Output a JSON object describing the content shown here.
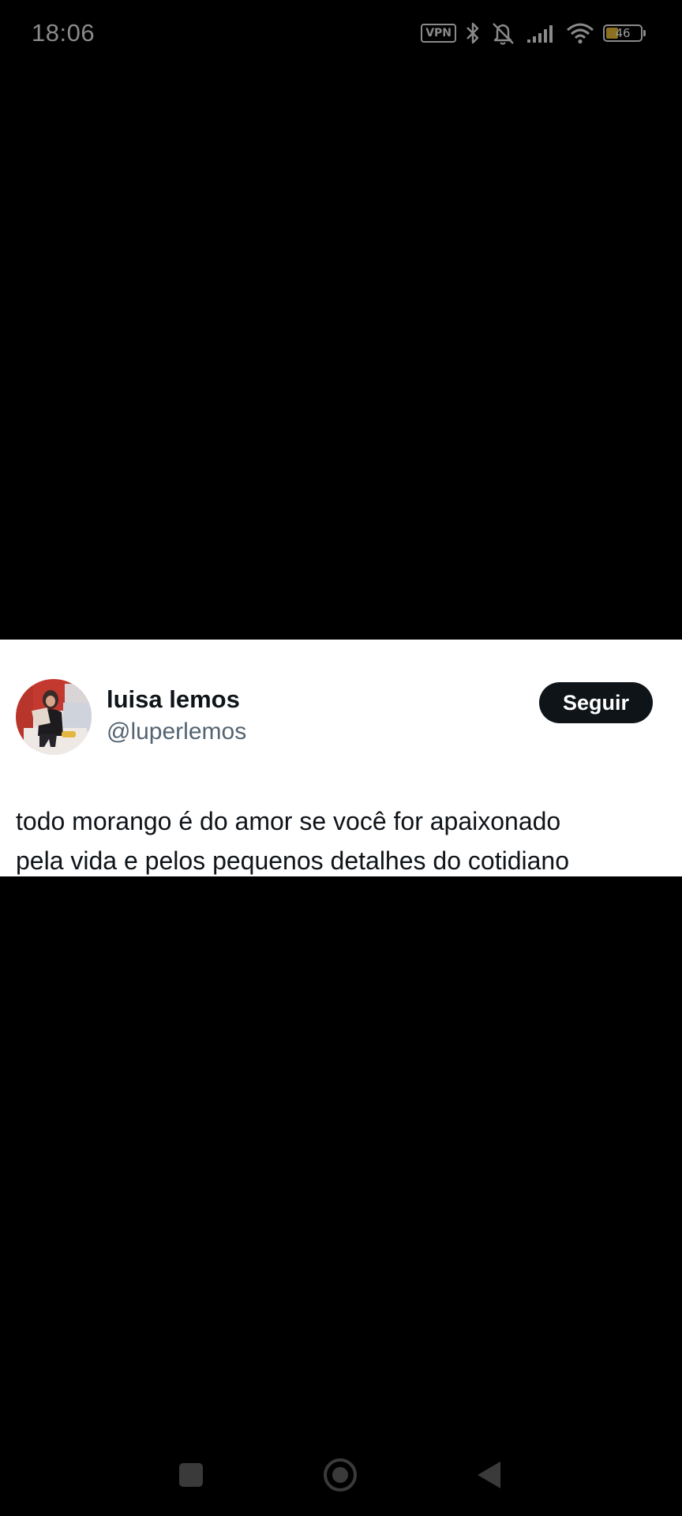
{
  "status_bar": {
    "time": "18:06",
    "vpn_label": "VPN",
    "battery_level": "46",
    "icon_color": "#8a8a8a",
    "icons": [
      "vpn-icon",
      "bluetooth-icon",
      "mute-icon",
      "signal-icon",
      "wifi-icon",
      "battery-icon"
    ]
  },
  "tweet": {
    "author_name": "luisa lemos",
    "author_handle": "@luperlemos",
    "follow_label": "Seguir",
    "text": "todo morango é do amor se você for apaixonado\npela vida e pelos pequenos detalhes do cotidiano",
    "colors": {
      "card_background": "#ffffff",
      "primary_text": "#0f1419",
      "secondary_text": "#536471",
      "button_background": "#0f1419"
    }
  },
  "nav_bar": {
    "icons": [
      "recents-icon",
      "home-icon",
      "back-icon"
    ],
    "icon_color": "#3a3a3a"
  }
}
